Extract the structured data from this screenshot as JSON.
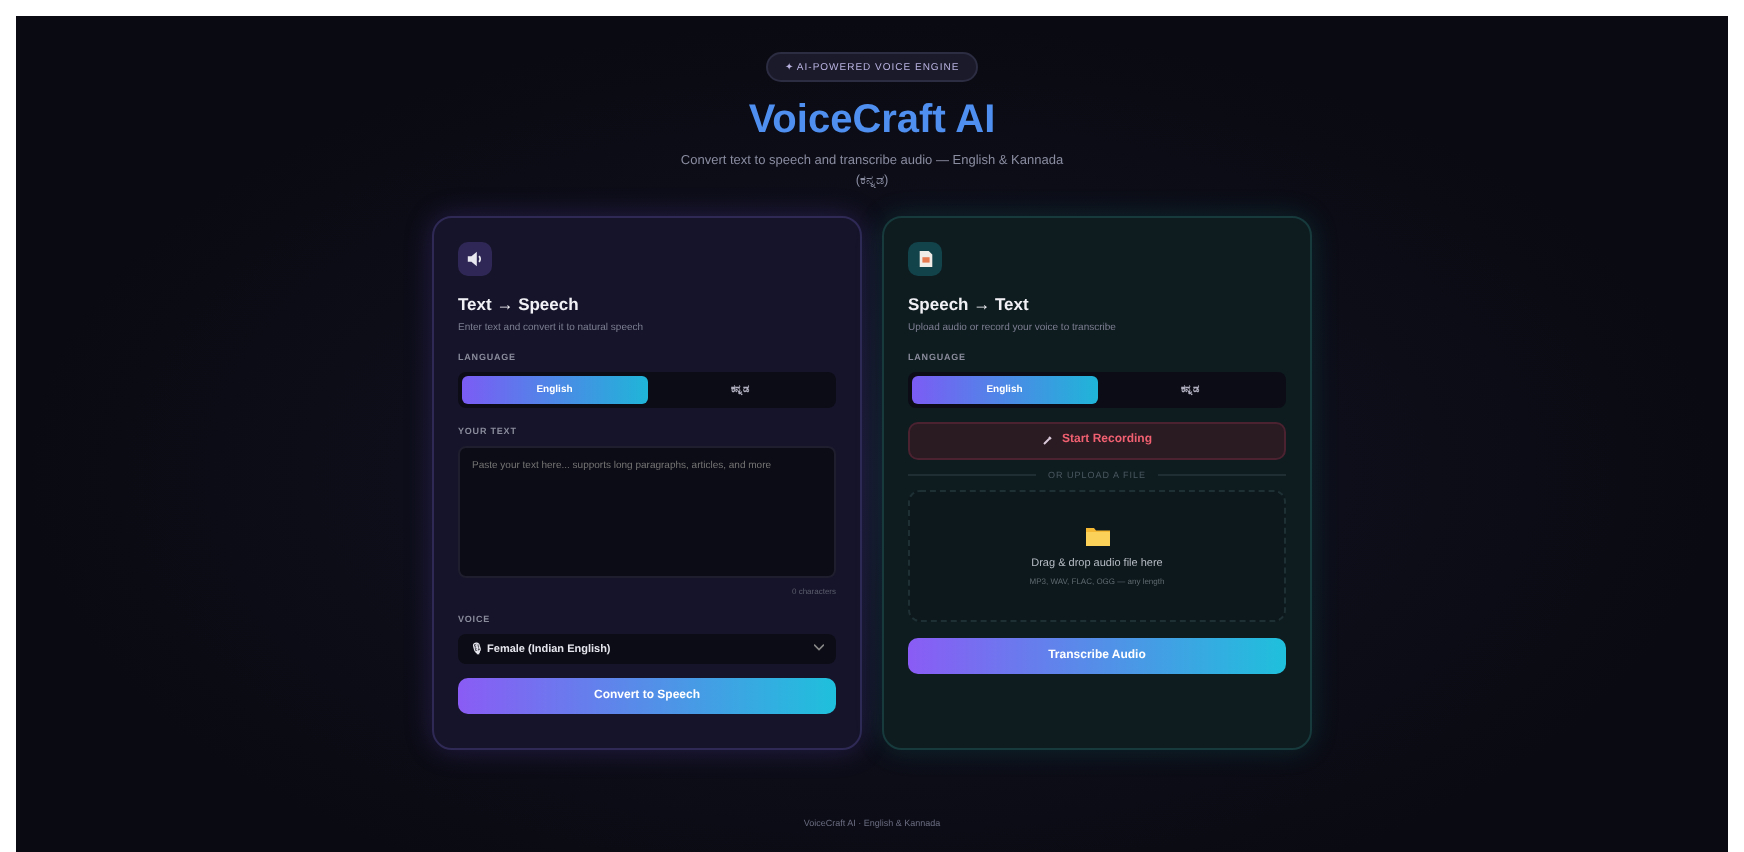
{
  "header": {
    "badge": "✦ AI-POWERED VOICE ENGINE",
    "title": "VoiceCraft AI",
    "subtitle": "Convert text to speech and transcribe audio — English & Kannada (ಕನ್ನಡ)"
  },
  "cards": [
    {
      "kind": "tts",
      "title": "Text → Speech",
      "description": "Enter text and convert it to natural speech",
      "language_label": "LANGUAGE",
      "languages": [
        {
          "label": "English",
          "selected": true
        },
        {
          "label": "ಕನ್ನಡ",
          "selected": false
        }
      ],
      "text_label": "YOUR TEXT",
      "text_placeholder": "Paste your text here... supports long paragraphs, articles, and more",
      "char_count": "0 characters",
      "voice_label": "VOICE",
      "voice": "🎙 Female (Indian English)",
      "button": "Convert to Speech"
    },
    {
      "kind": "stt",
      "title": "Speech → Text",
      "description": "Upload audio or record your voice to transcribe",
      "language_label": "LANGUAGE",
      "languages": [
        {
          "label": "English",
          "selected": true
        },
        {
          "label": "ಕನ್ನಡ",
          "selected": false
        }
      ],
      "record_button": "Start Recording",
      "divider": "OR UPLOAD A FILE",
      "drop_title": "Drag & drop audio file here",
      "drop_hint": "MP3, WAV, FLAC, OGG — any length",
      "button": "Transcribe Audio"
    }
  ],
  "footer": "VoiceCraft AI · English & Kannada"
}
